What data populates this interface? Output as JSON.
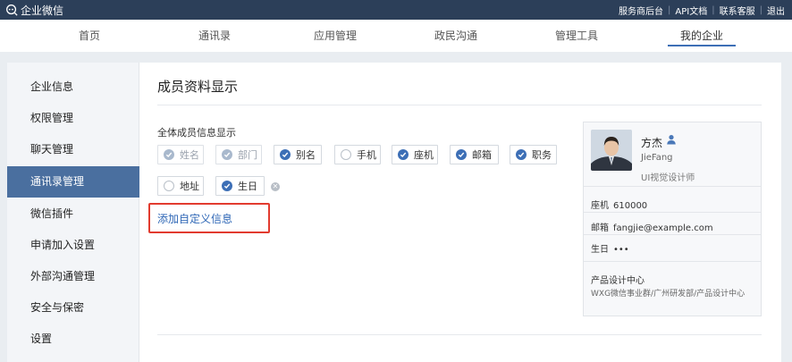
{
  "topbar": {
    "app_name": "企业微信",
    "links": [
      "服务商后台",
      "API文档",
      "联系客服",
      "退出"
    ]
  },
  "nav": {
    "tabs": [
      "首页",
      "通讯录",
      "应用管理",
      "政民沟通",
      "管理工具",
      "我的企业"
    ],
    "active_tab": "我的企业"
  },
  "sidebar": {
    "items": [
      "企业信息",
      "权限管理",
      "聊天管理",
      "通讯录管理",
      "微信插件",
      "申请加入设置",
      "外部沟通管理",
      "安全与保密",
      "设置"
    ],
    "active_item": "通讯录管理"
  },
  "main": {
    "title": "成员资料显示",
    "section_label": "全体成员信息显示",
    "fields": [
      {
        "label": "姓名",
        "state": "disabled"
      },
      {
        "label": "部门",
        "state": "disabled"
      },
      {
        "label": "别名",
        "state": "checked"
      },
      {
        "label": "手机",
        "state": "unchecked"
      },
      {
        "label": "座机",
        "state": "checked"
      },
      {
        "label": "邮箱",
        "state": "checked"
      },
      {
        "label": "职务",
        "state": "checked"
      },
      {
        "label": "地址",
        "state": "unchecked"
      },
      {
        "label": "生日",
        "state": "checked"
      }
    ],
    "add_custom_link": "添加自定义信息"
  },
  "preview_card": {
    "name": "方杰",
    "english_name": "JieFang",
    "title": "UI视觉设计师",
    "landline_label": "座机",
    "landline_value": "610000",
    "email_label": "邮箱",
    "email_value": "fangjie@example.com",
    "birthday_label": "生日",
    "birthday_value": "•••",
    "department": "产品设计中心",
    "department_path": "WXG微信事业群/广州研发部/产品设计中心"
  },
  "colors": {
    "topbar_bg": "#2c3f59",
    "accent": "#3d6fb6",
    "sidebar_active_bg": "#4a6f9f",
    "highlight_red": "#e23b2f",
    "link": "#2f67b6"
  }
}
